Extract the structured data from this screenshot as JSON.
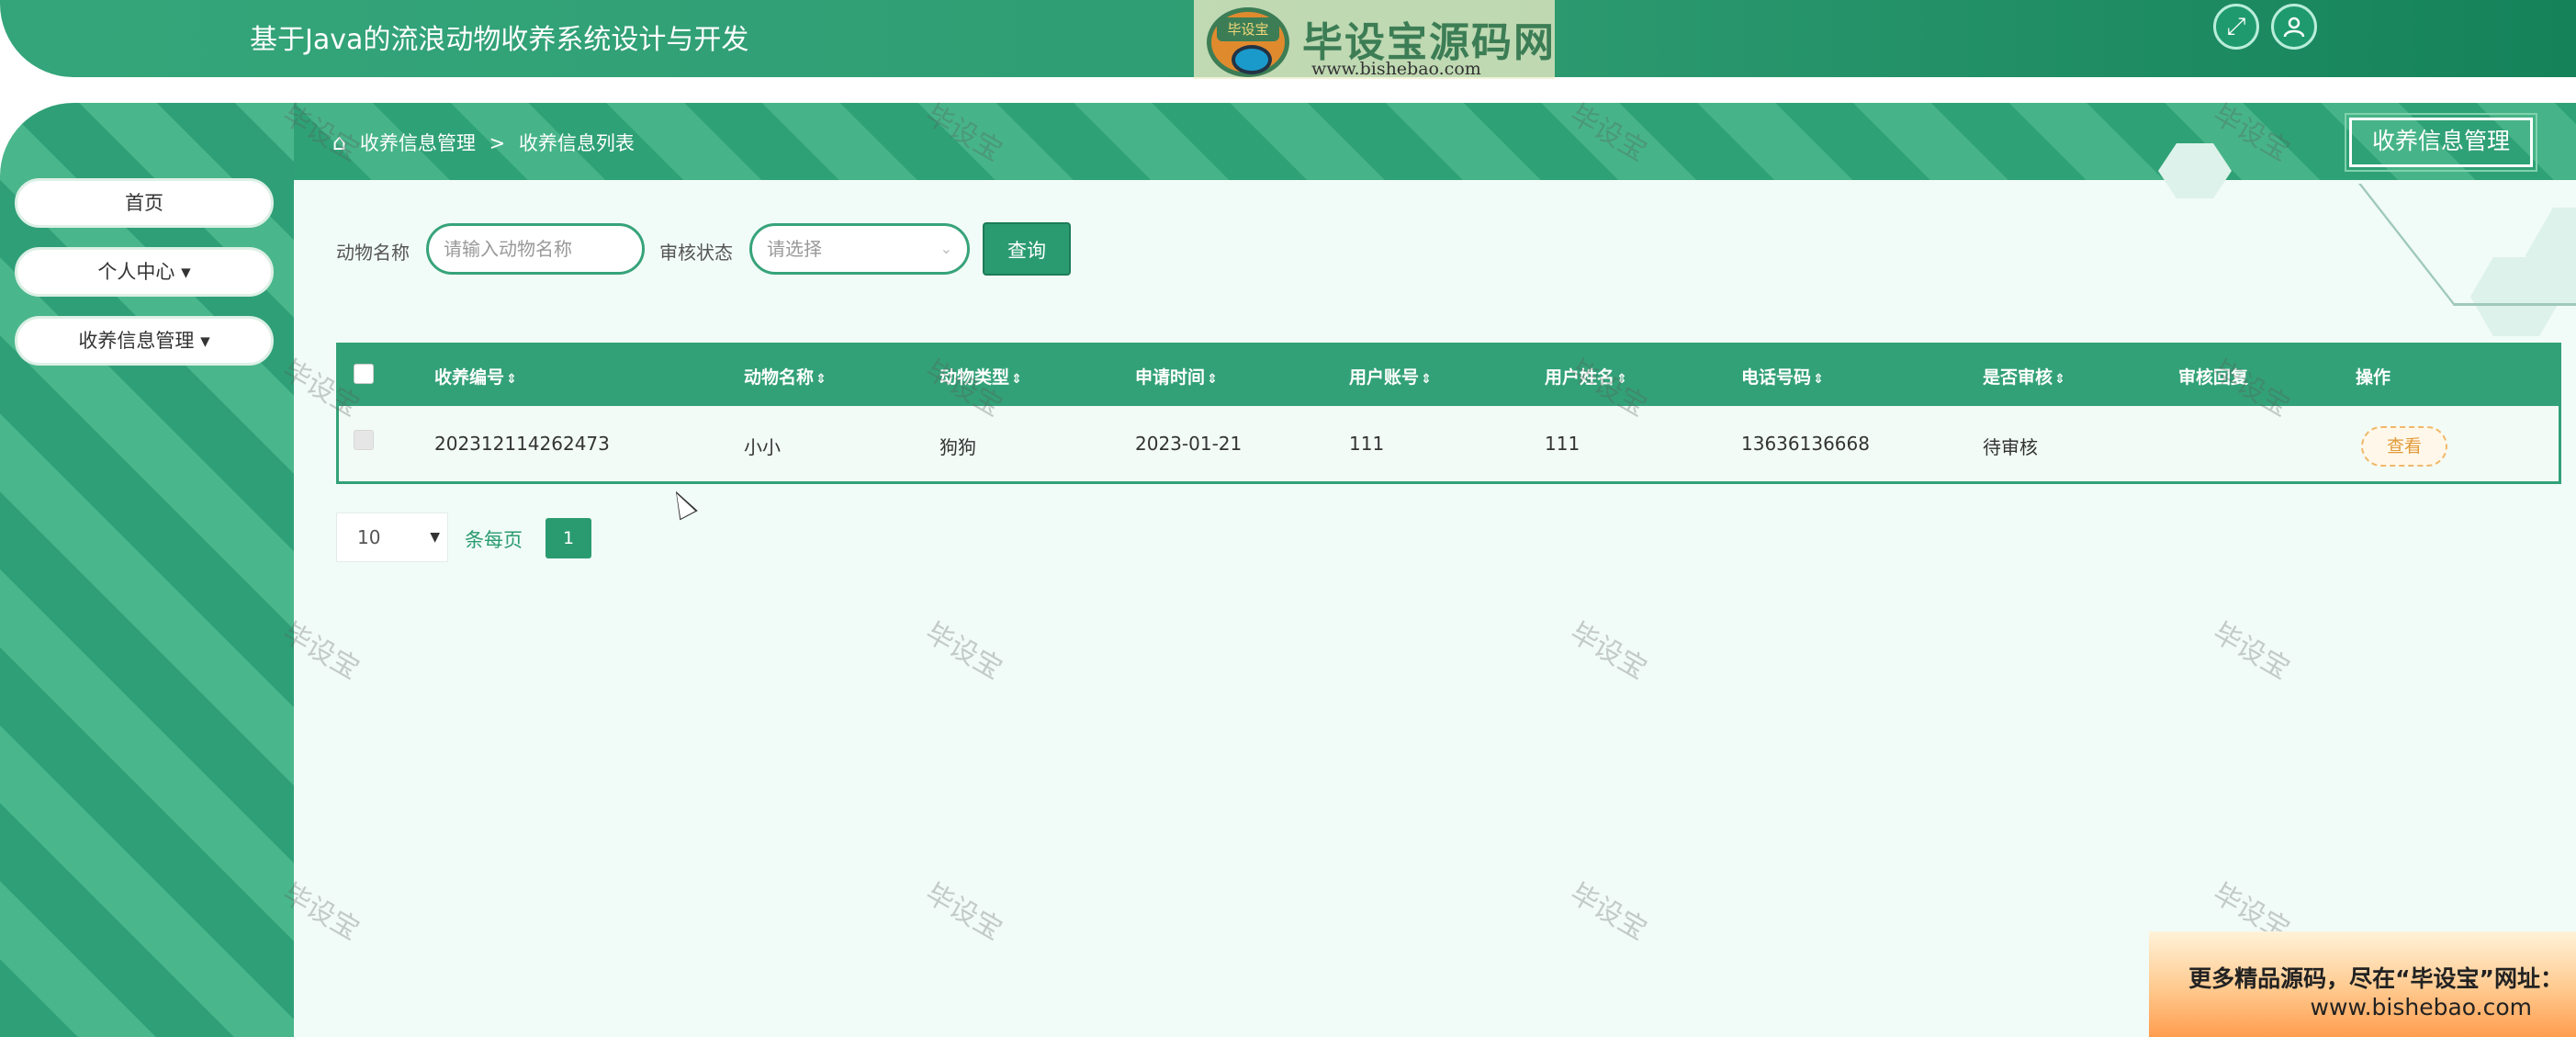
{
  "header": {
    "app_title": "基于Java的流浪动物收养系统设计与开发",
    "logo_badge": "毕设宝",
    "logo_text": "毕设宝源码网",
    "logo_url": "www.bishebao.com",
    "fullscreen_icon": "fullscreen-icon",
    "user_icon": "user-icon"
  },
  "sidebar": {
    "items": [
      {
        "label": "首页"
      },
      {
        "label": "个人中心 ▾"
      },
      {
        "label": "收养信息管理 ▾"
      }
    ]
  },
  "breadcrumb": {
    "home_icon": "home-icon",
    "level1": "收养信息管理",
    "separator": ">",
    "level2": "收养信息列表"
  },
  "page_title": "收养信息管理",
  "search": {
    "animal_label": "动物名称",
    "animal_placeholder": "请输入动物名称",
    "status_label": "审核状态",
    "status_placeholder": "请选择",
    "query_label": "查询"
  },
  "table": {
    "columns": [
      "收养编号",
      "动物名称",
      "动物类型",
      "申请时间",
      "用户账号",
      "用户姓名",
      "电话号码",
      "是否审核",
      "审核回复",
      "操作"
    ],
    "rows": [
      {
        "adopt_no": "202312114262473",
        "animal_name": "小小",
        "animal_type": "狗狗",
        "apply_time": "2023-01-21",
        "user_account": "111",
        "user_name": "111",
        "phone": "13636136668",
        "review_status": "待审核",
        "review_reply": "",
        "action": "查看"
      }
    ]
  },
  "pagination": {
    "page_size": "10",
    "per_page_label": "条每页",
    "current_page": "1"
  },
  "watermark": "毕设宝",
  "promo": {
    "line1": "更多精品源码，尽在“毕设宝”网址：",
    "line2": "www.bishebao.com"
  },
  "colors": {
    "primary": "#2a9b70",
    "accent_orange": "#e39a3a",
    "background": "#f1fbf8"
  }
}
